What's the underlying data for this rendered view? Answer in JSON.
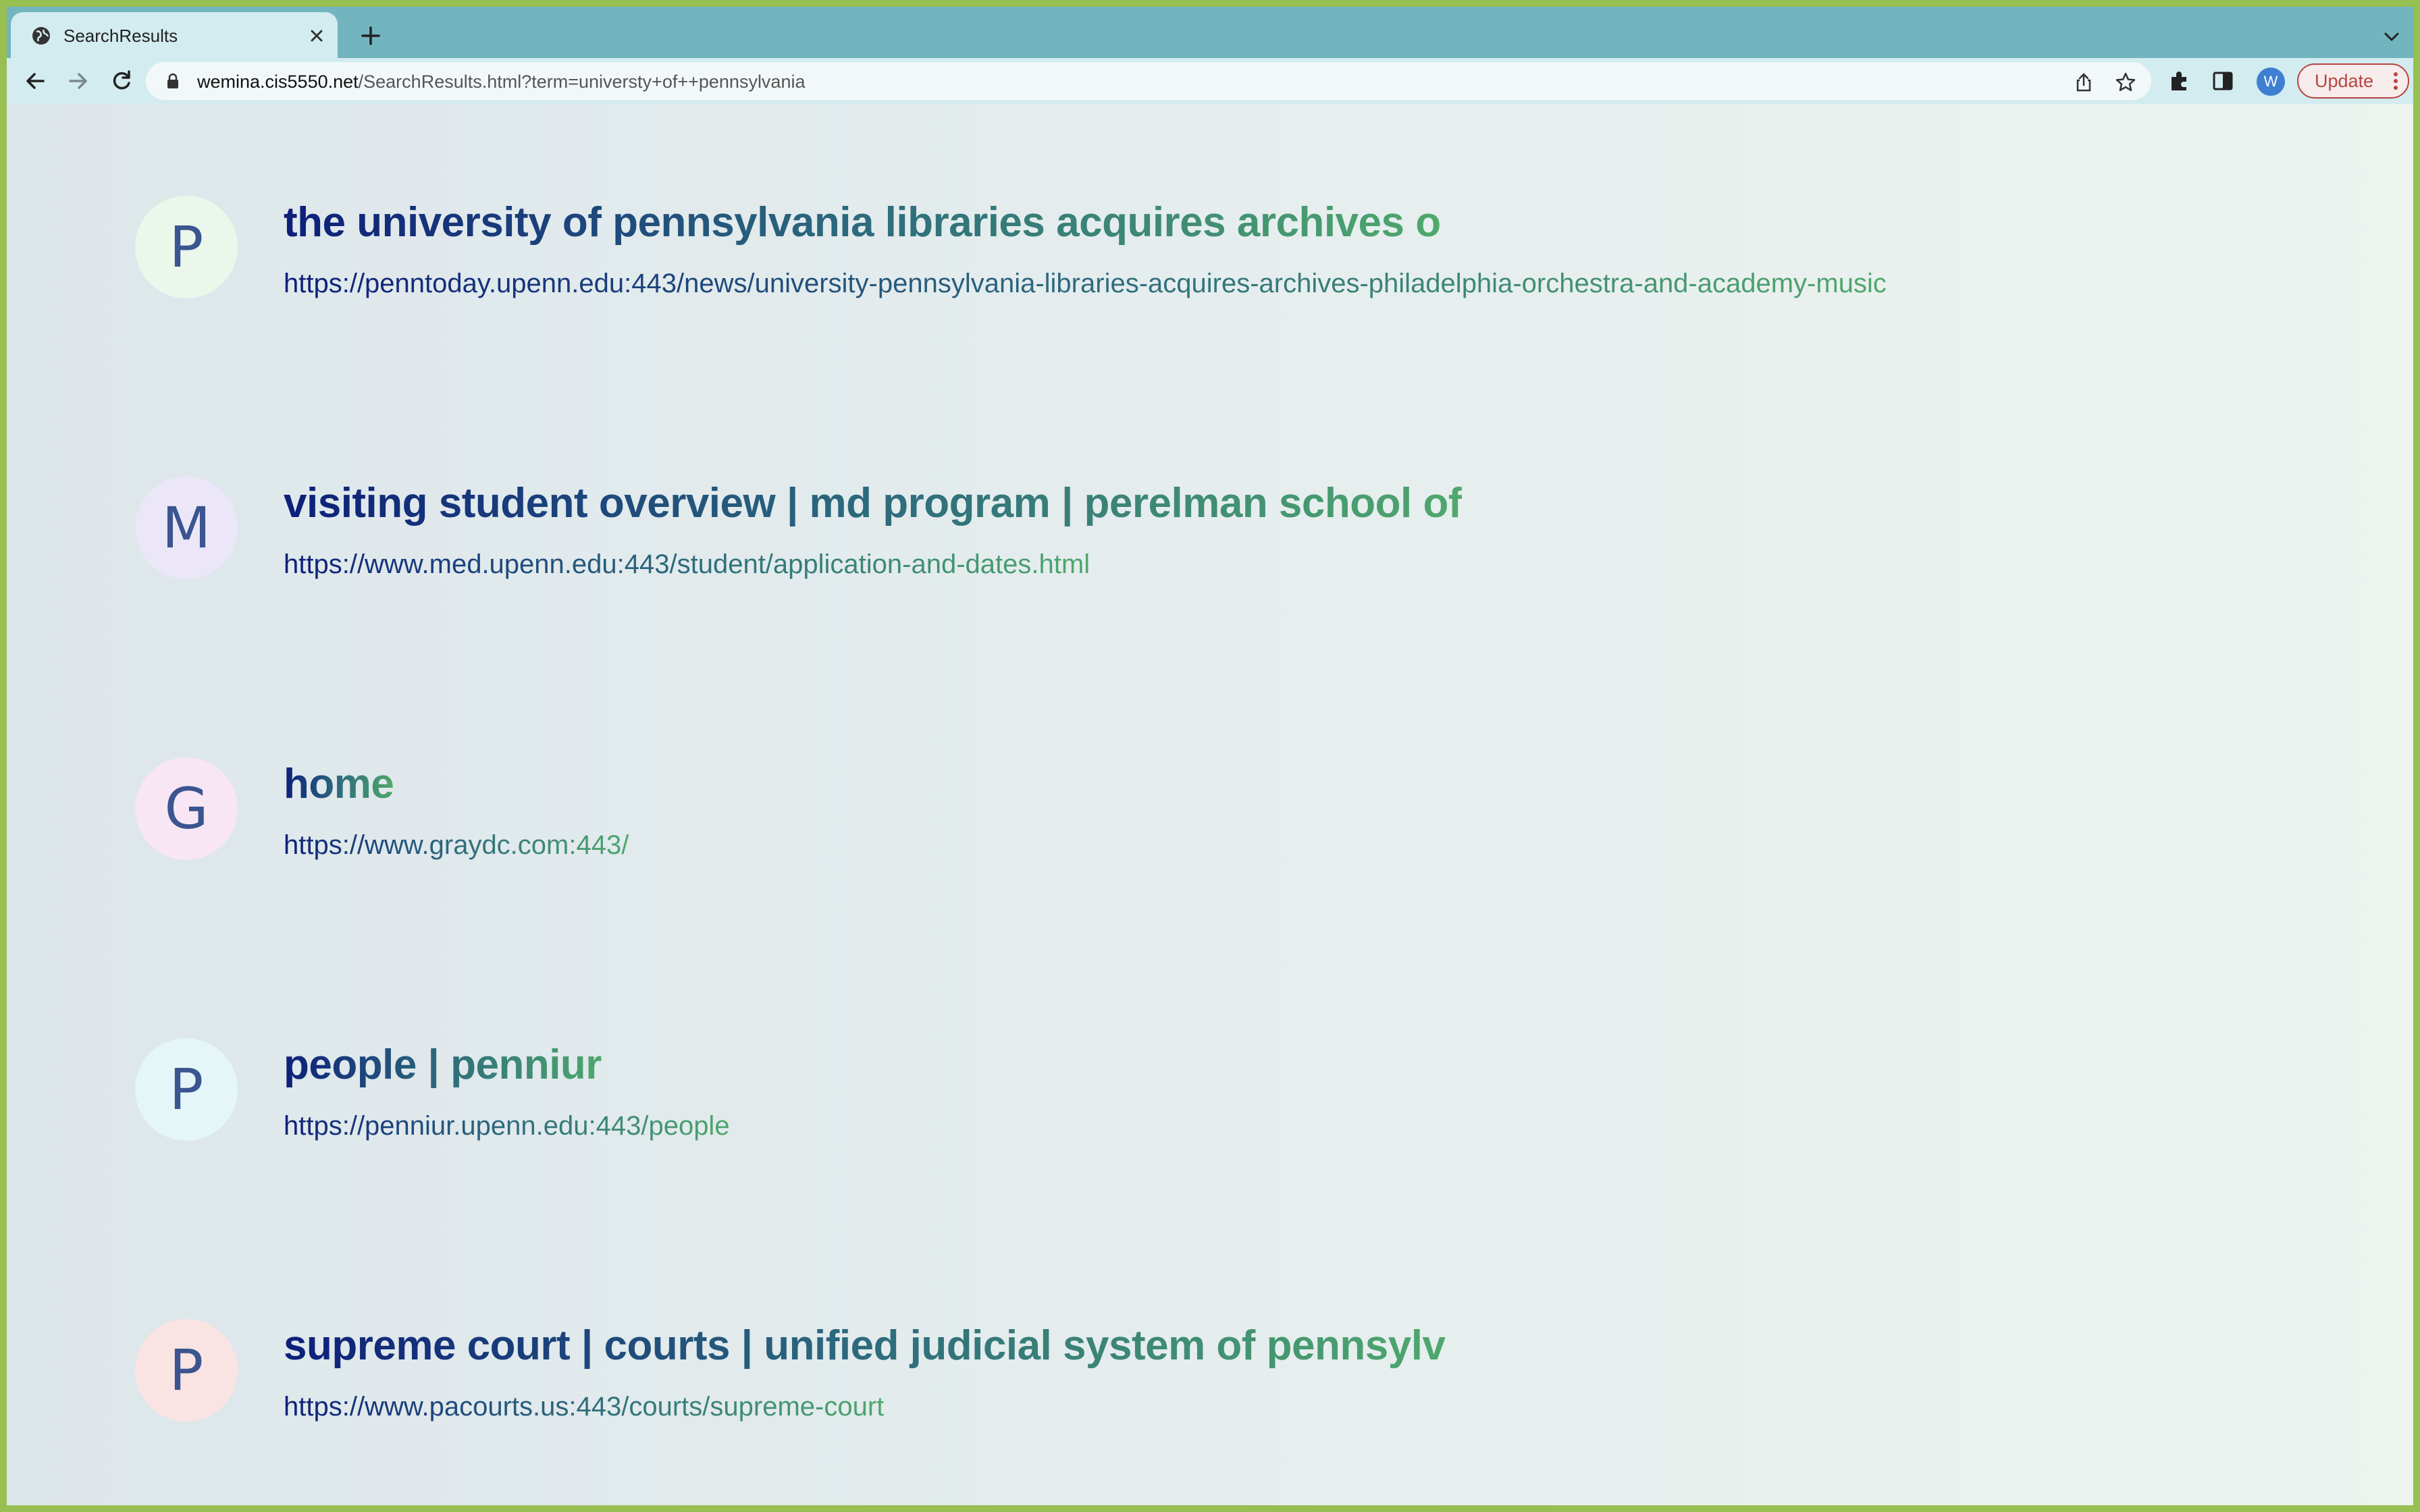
{
  "browser": {
    "tab_title": "SearchResults",
    "url_host": "wemina.cis5550.net",
    "url_path": "/SearchResults.html?term=universty+of++pennsylvania",
    "profile_initial": "W",
    "update_label": "Update"
  },
  "results": [
    {
      "initial": "P",
      "avatar_color": "#eaf7ea",
      "title": "the university of pennsylvania libraries acquires archives o",
      "url": "https://penntoday.upenn.edu:443/news/university-pennsylvania-libraries-acquires-archives-philadelphia-orchestra-and-academy-music"
    },
    {
      "initial": "M",
      "avatar_color": "#ebe6f8",
      "title": "visiting student overview | md program | perelman school of",
      "url": "https://www.med.upenn.edu:443/student/application-and-dates.html"
    },
    {
      "initial": "G",
      "avatar_color": "#f8e6f4",
      "title": "home",
      "url": "https://www.graydc.com:443/"
    },
    {
      "initial": "P",
      "avatar_color": "#e4f6f8",
      "title": "people | penniur",
      "url": "https://penniur.upenn.edu:443/people"
    },
    {
      "initial": "P",
      "avatar_color": "#fae3e3",
      "title": "supreme court | courts | unified judicial system of pennsylv",
      "url": "https://www.pacourts.us:443/courts/supreme-court"
    }
  ]
}
